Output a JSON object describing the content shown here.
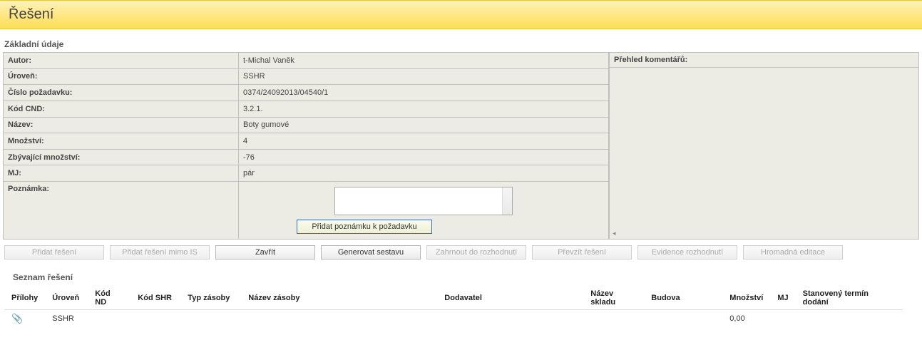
{
  "header": {
    "title": "Řešení"
  },
  "basic": {
    "section_title": "Základní údaje",
    "rows": {
      "autor_label": "Autor:",
      "autor_value": "t-Michal Vaněk",
      "uroven_label": "Úroveň:",
      "uroven_value": "SSHR",
      "cislo_label": "Číslo požadavku:",
      "cislo_value": "0374/24092013/04540/1",
      "kod_label": "Kód CND:",
      "kod_value": "3.2.1.",
      "nazev_label": "Název:",
      "nazev_value": "Boty gumové",
      "mnoz_label": "Množství:",
      "mnoz_value": "4",
      "zbyv_label": "Zbývající množství:",
      "zbyv_value": "-76",
      "mj_label": "MJ:",
      "mj_value": "pár",
      "pozn_label": "Poznámka:"
    },
    "add_note_btn": "Přidat poznámku k požadavku"
  },
  "comments": {
    "title": "Přehled komentářů:"
  },
  "buttons": {
    "pridat": "Přidat řešení",
    "pridat_mimo": "Přidat řešení mimo IS",
    "zavrit": "Zavřít",
    "generovat": "Generovat sestavu",
    "zahrnout": "Zahrnout do rozhodnutí",
    "prevzit": "Převzít řešení",
    "evidence": "Evidence rozhodnutí",
    "hromadna": "Hromadná editace"
  },
  "list": {
    "title": "Seznam řešení",
    "headers": {
      "prilohy": "Přílohy",
      "uroven": "Úroveň",
      "kodnd": "Kód ND",
      "kodshr": "Kód SHR",
      "typ": "Typ zásoby",
      "nazevz": "Název zásoby",
      "dodavatel": "Dodavatel",
      "sklad": "Název skladu",
      "budova": "Budova",
      "mnoz": "Množství",
      "mj": "MJ",
      "termin": "Stanovený termín dodání"
    },
    "rows": [
      {
        "uroven": "SSHR",
        "kodnd": "",
        "kodshr": "",
        "typ": "",
        "nazevz": "",
        "dodavatel": "",
        "sklad": "",
        "budova": "",
        "mnoz": "0,00",
        "mj": "",
        "termin": ""
      }
    ]
  }
}
